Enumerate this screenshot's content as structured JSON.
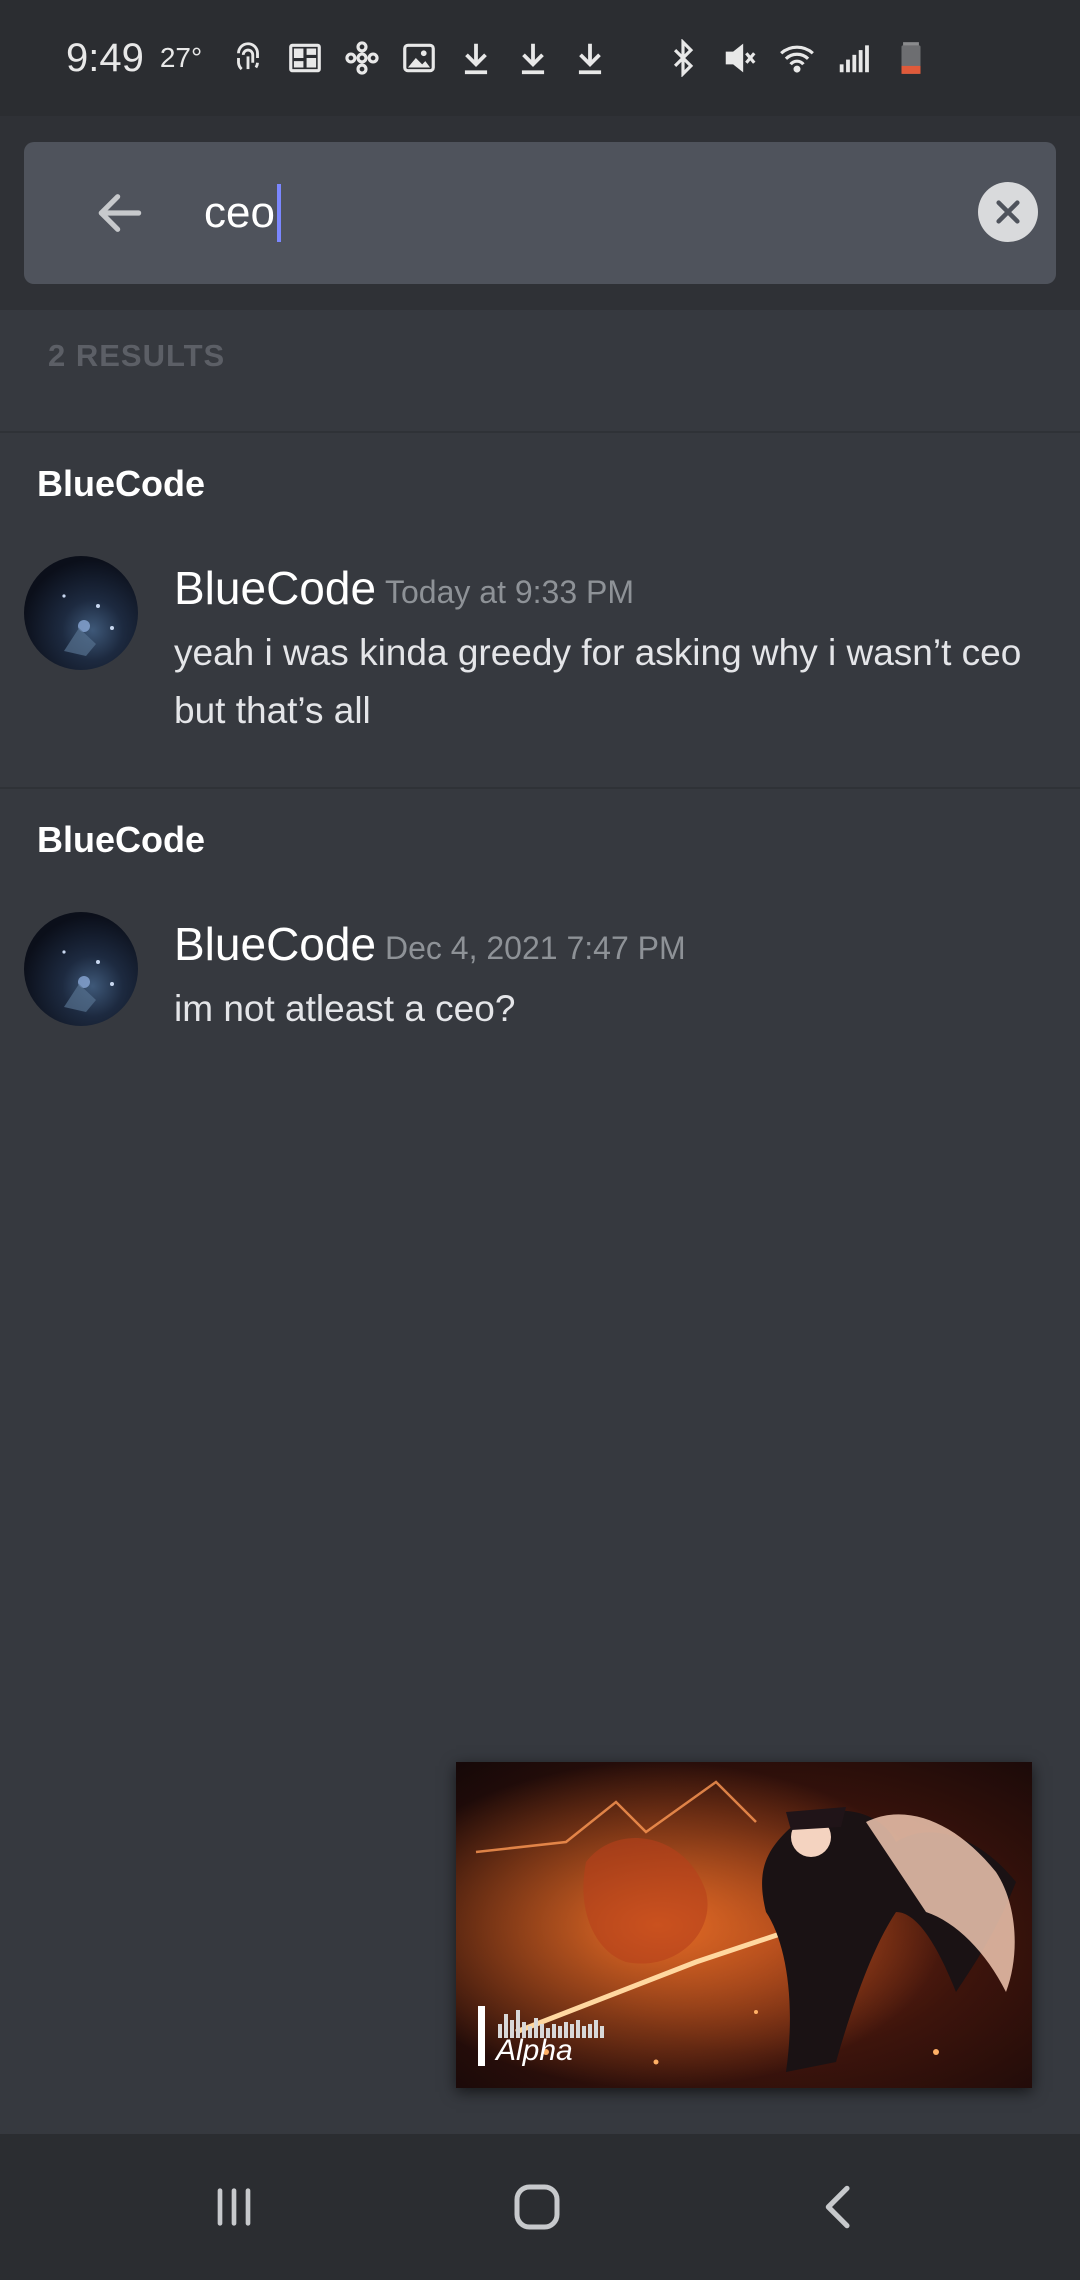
{
  "status_bar": {
    "time": "9:49",
    "temperature": "27°",
    "icons": [
      "fingerprint-icon",
      "gallery-stack-icon",
      "pinwheel-icon",
      "image-icon",
      "download-icon",
      "download-icon",
      "download-icon",
      "bluetooth-icon",
      "mute-icon",
      "wifi-icon",
      "signal-icon",
      "battery-icon"
    ],
    "battery_color": "#e05a3a"
  },
  "search": {
    "query": "ceo",
    "back_icon": "arrow-left-icon",
    "clear_icon": "close-circle-icon",
    "caret_color": "#7b87ff"
  },
  "results": {
    "count_label": "2 RESULTS",
    "items": [
      {
        "channel": "BlueCode",
        "author": "BlueCode",
        "timestamp": "Today at 9:33 PM",
        "message": "yeah i was kinda greedy for asking why i wasn’t ceo but that’s all"
      },
      {
        "channel": "BlueCode",
        "author": "BlueCode",
        "timestamp": "Dec 4, 2021 7:47 PM",
        "message": "im not atleast a ceo?"
      }
    ]
  },
  "video_pip": {
    "title": "Alpha"
  },
  "nav_bar": {
    "recents_icon": "recents-icon",
    "home_icon": "home-icon",
    "back_icon": "chevron-left-icon"
  },
  "colors": {
    "background": "#36393f",
    "header": "#2f3136",
    "search_box": "#4f535c",
    "timestamp": "#8e9297"
  }
}
